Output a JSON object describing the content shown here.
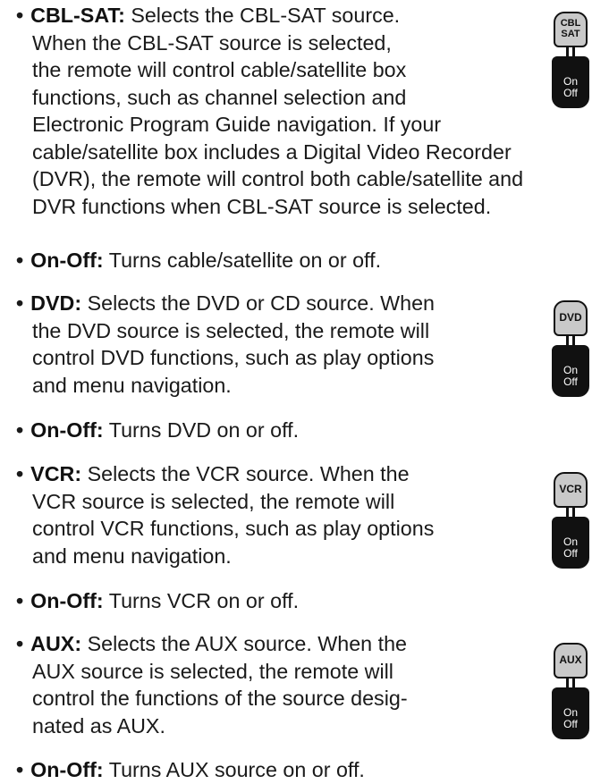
{
  "items": [
    {
      "term": "CBL-SAT:",
      "lines": [
        " Selects the CBL-SAT source.",
        "When the CBL-SAT source is selected,",
        "the remote will control cable/satellite box",
        "functions, such as channel selection and",
        "Electronic Program Guide navigation. If your",
        "cable/satellite box includes a Digital Video Recorder",
        "(DVR), the remote will control both cable/satellite and",
        "DVR functions when CBL-SAT source is selected."
      ]
    },
    {
      "term": "On-Off:",
      "lines": [
        " Turns cable/satellite on or off."
      ]
    },
    {
      "term": "DVD:",
      "lines": [
        " Selects the DVD or CD source. When",
        "the DVD source is selected, the remote will",
        "control DVD functions, such as play options",
        "and menu navigation."
      ]
    },
    {
      "term": "On-Off:",
      "lines": [
        " Turns DVD on or off."
      ]
    },
    {
      "term": "VCR:",
      "lines": [
        " Selects the VCR source. When the",
        "VCR source is selected, the remote will",
        "control VCR functions, such as play options",
        "and menu navigation."
      ]
    },
    {
      "term": "On-Off:",
      "lines": [
        " Turns VCR on or off."
      ]
    },
    {
      "term": "AUX:",
      "lines": [
        " Selects the AUX source. When the",
        "AUX source is selected, the remote will",
        "control the functions of the source desig-",
        "nated as AUX."
      ]
    },
    {
      "term": "On-Off:",
      "lines": [
        " Turns AUX source on or off."
      ]
    }
  ],
  "bullet": "•",
  "remotes": [
    {
      "source_label_1": "CBL",
      "source_label_2": "SAT",
      "on_label": "On",
      "off_label": "Off"
    },
    {
      "source_label": "DVD",
      "on_label": "On",
      "off_label": "Off"
    },
    {
      "source_label": "VCR",
      "on_label": "On",
      "off_label": "Off"
    },
    {
      "source_label": "AUX",
      "on_label": "On",
      "off_label": "Off"
    }
  ]
}
